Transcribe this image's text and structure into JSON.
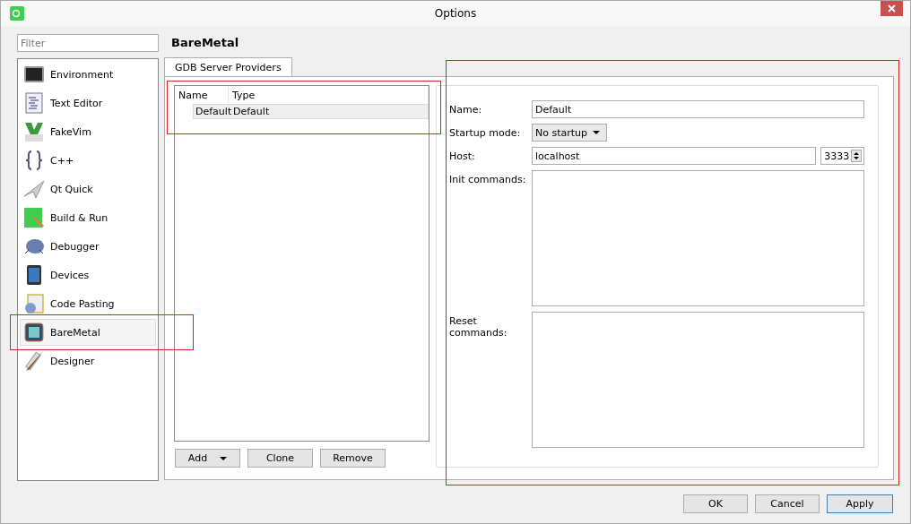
{
  "window": {
    "title": "Options"
  },
  "filter": {
    "placeholder": "Filter"
  },
  "categories": [
    {
      "label": "Environment",
      "selected": false
    },
    {
      "label": "Text Editor",
      "selected": false
    },
    {
      "label": "FakeVim",
      "selected": false
    },
    {
      "label": "C++",
      "selected": false
    },
    {
      "label": "Qt Quick",
      "selected": false
    },
    {
      "label": "Build & Run",
      "selected": false
    },
    {
      "label": "Debugger",
      "selected": false
    },
    {
      "label": "Devices",
      "selected": false
    },
    {
      "label": "Code Pasting",
      "selected": false
    },
    {
      "label": "BareMetal",
      "selected": true
    },
    {
      "label": "Designer",
      "selected": false
    }
  ],
  "page_title": "BareMetal",
  "tabs": [
    {
      "label": "GDB Server Providers",
      "selected": true
    }
  ],
  "providers": {
    "columns": [
      "Name",
      "Type"
    ],
    "rows": [
      {
        "cells": [
          "Default",
          "Default"
        ],
        "selected": true
      }
    ]
  },
  "list_buttons": [
    {
      "label": "Add",
      "kind": "menu"
    },
    {
      "label": "Clone",
      "kind": "plain"
    },
    {
      "label": "Remove",
      "kind": "plain"
    }
  ],
  "form": {
    "name_label": "Name:",
    "name_value": "Default",
    "startup_label": "Startup mode:",
    "startup_value": "No startup",
    "host_label": "Host:",
    "host_value": "localhost",
    "port_value": "3333",
    "init_label": "Init commands:",
    "reset_label": "Reset commands:"
  },
  "dialog_buttons": [
    {
      "label": "OK",
      "default": false
    },
    {
      "label": "Cancel",
      "default": false
    },
    {
      "label": "Apply",
      "default": true
    }
  ]
}
